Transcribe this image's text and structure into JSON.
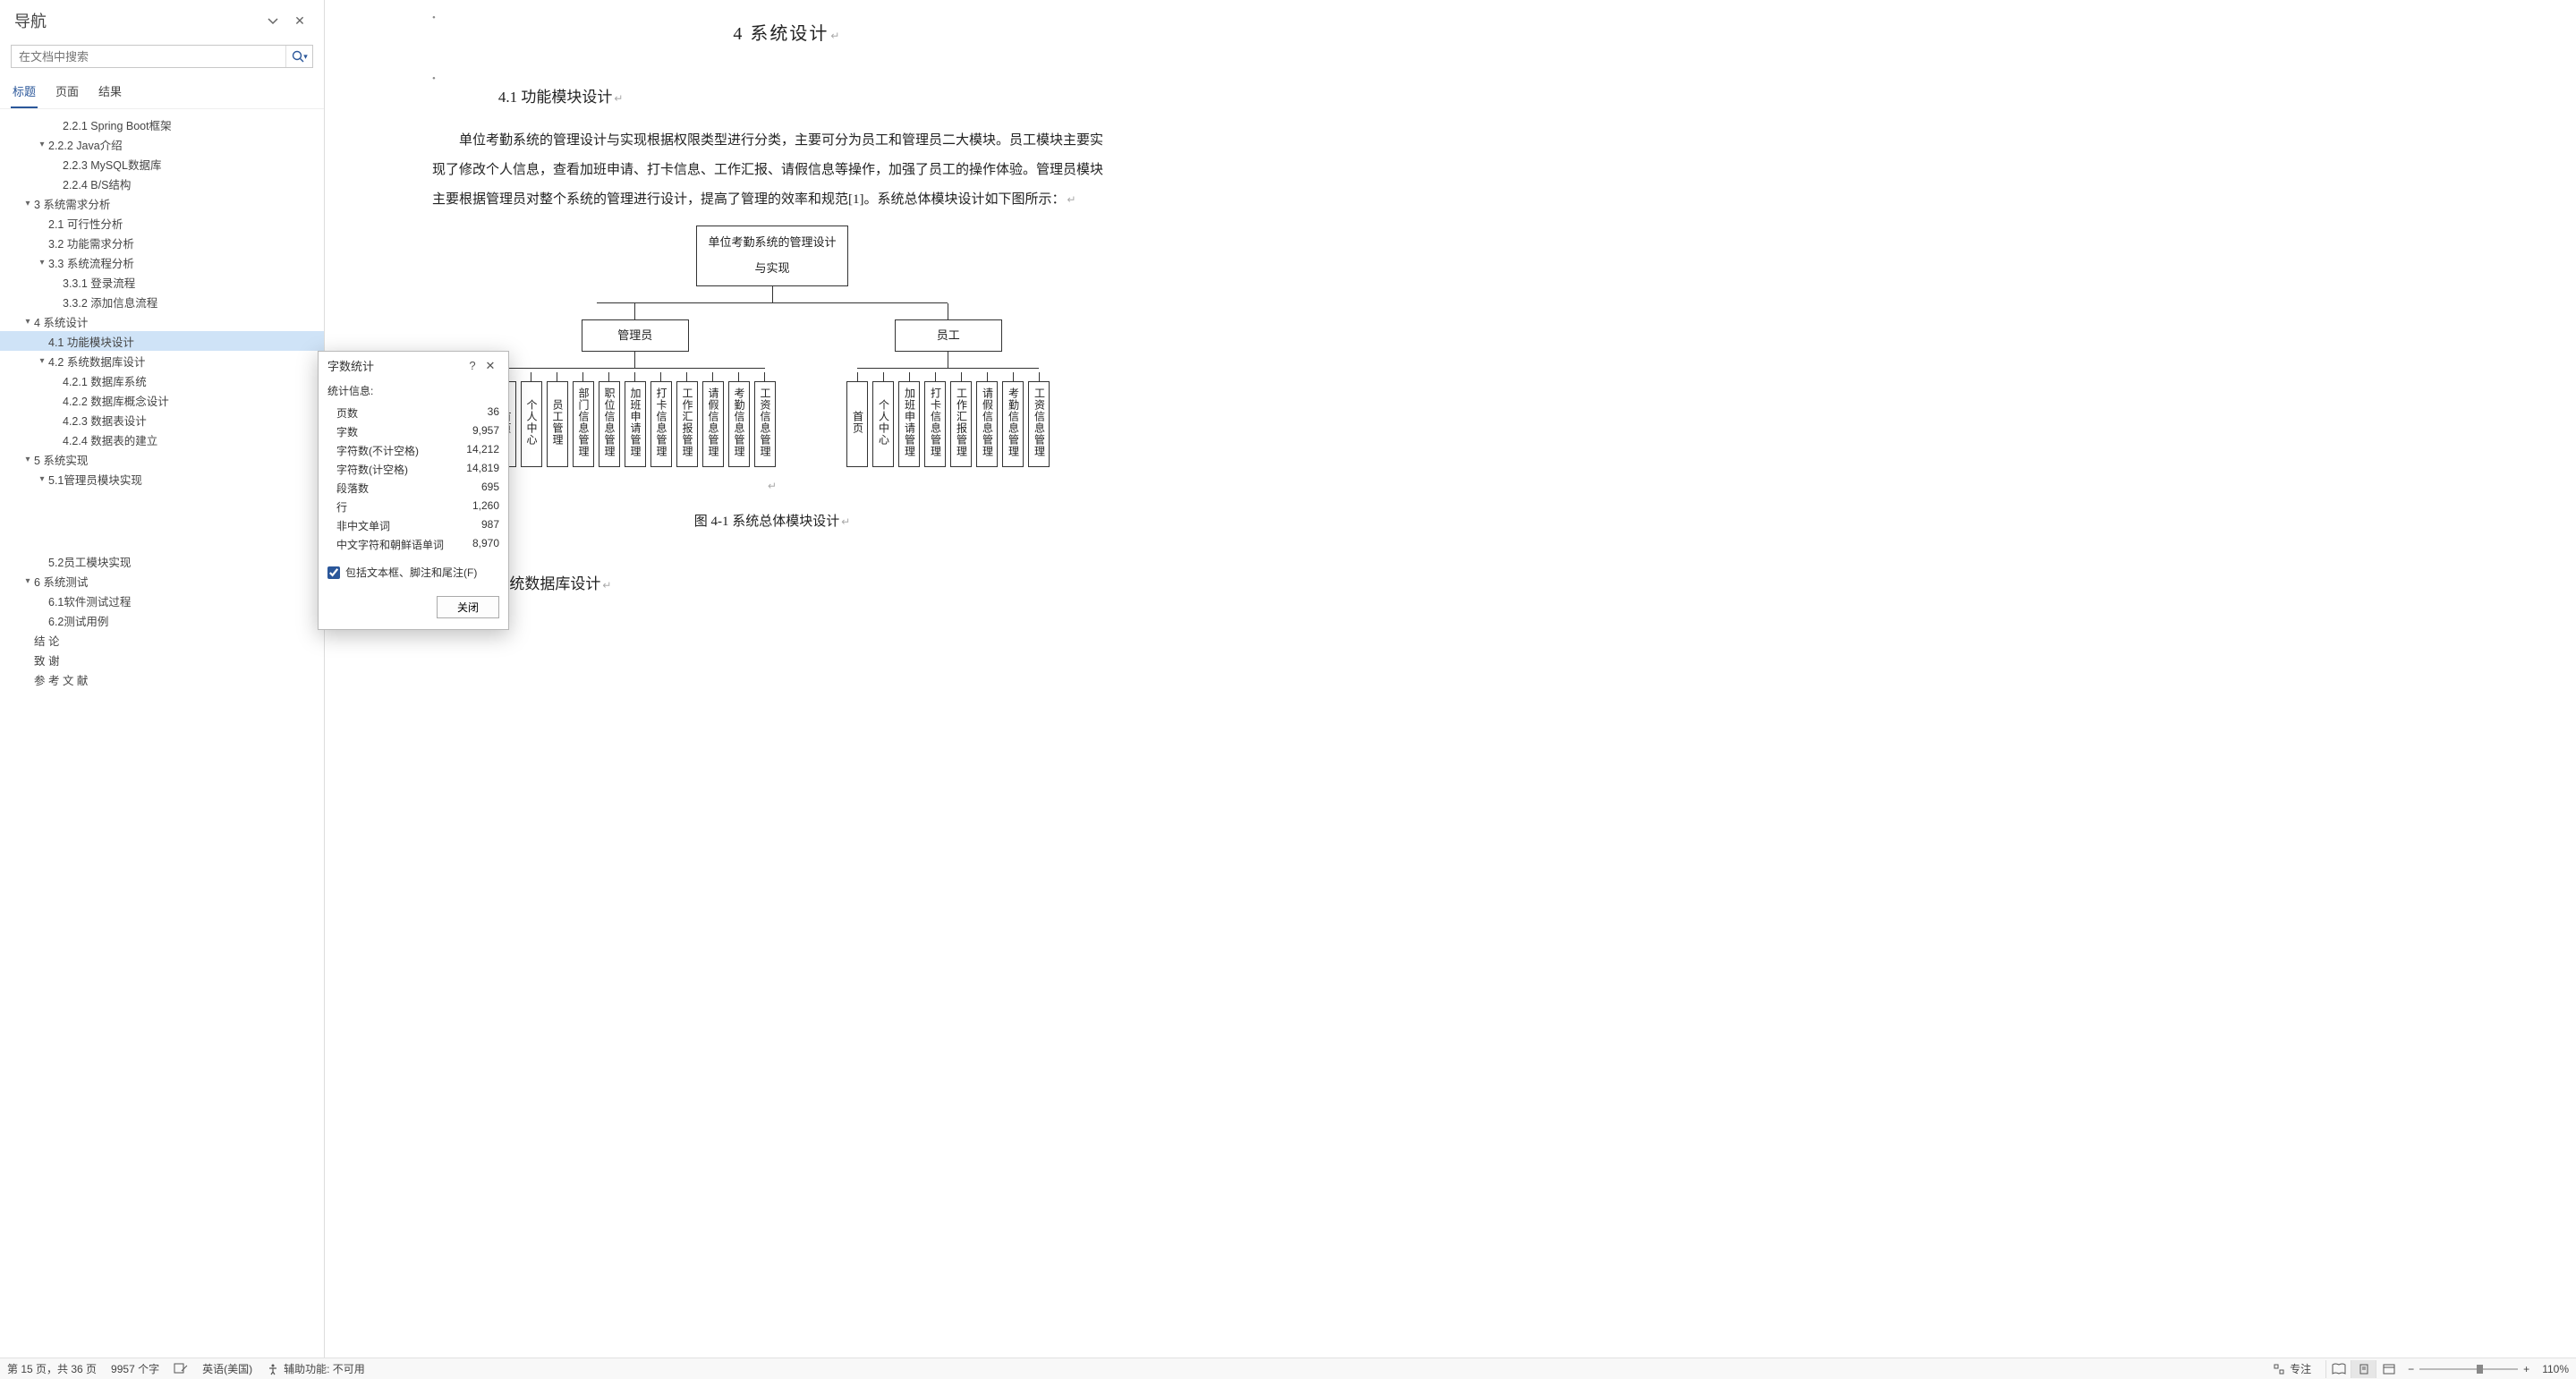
{
  "nav": {
    "title": "导航",
    "search_placeholder": "在文档中搜索",
    "tabs": {
      "headings": "标题",
      "pages": "页面",
      "results": "结果"
    },
    "tree": [
      {
        "level": 3,
        "caret": "",
        "label": "2.2.1 Spring Boot框架"
      },
      {
        "level": 2,
        "caret": "▾",
        "label": "2.2.2 Java介绍"
      },
      {
        "level": 3,
        "caret": "",
        "label": "2.2.3 MySQL数据库"
      },
      {
        "level": 3,
        "caret": "",
        "label": "2.2.4 B/S结构"
      },
      {
        "level": 1,
        "caret": "▾",
        "label": "3  系统需求分析"
      },
      {
        "level": 2,
        "caret": "",
        "label": "2.1 可行性分析"
      },
      {
        "level": 2,
        "caret": "",
        "label": "3.2 功能需求分析"
      },
      {
        "level": 2,
        "caret": "▾",
        "label": "3.3 系统流程分析"
      },
      {
        "level": 3,
        "caret": "",
        "label": "3.3.1 登录流程"
      },
      {
        "level": 3,
        "caret": "",
        "label": "3.3.2 添加信息流程"
      },
      {
        "level": 1,
        "caret": "▾",
        "label": "4  系统设计"
      },
      {
        "level": 2,
        "caret": "",
        "label": "4.1 功能模块设计",
        "selected": true
      },
      {
        "level": 2,
        "caret": "▾",
        "label": "4.2 系统数据库设计"
      },
      {
        "level": 3,
        "caret": "",
        "label": "4.2.1 数据库系统"
      },
      {
        "level": 3,
        "caret": "",
        "label": "4.2.2 数据库概念设计"
      },
      {
        "level": 3,
        "caret": "",
        "label": "4.2.3 数据表设计"
      },
      {
        "level": 3,
        "caret": "",
        "label": "4.2.4 数据表的建立"
      },
      {
        "level": 1,
        "caret": "▾",
        "label": "5  系统实现"
      },
      {
        "level": 2,
        "caret": "▾",
        "label": "5.1管理员模块实现"
      },
      {
        "level": 2,
        "caret": "",
        "label": "5.2员工模块实现",
        "gap_before": true
      },
      {
        "level": 1,
        "caret": "▾",
        "label": "6  系统测试"
      },
      {
        "level": 2,
        "caret": "",
        "label": "6.1软件测试过程"
      },
      {
        "level": 2,
        "caret": "",
        "label": "6.2测试用例"
      },
      {
        "level": 1,
        "caret": "",
        "label": "结  论"
      },
      {
        "level": 1,
        "caret": "",
        "label": "致  谢"
      },
      {
        "level": 1,
        "caret": "",
        "label": "参 考 文 献"
      }
    ]
  },
  "doc": {
    "h1": "4  系统设计",
    "h2a": "4.1 功能模块设计",
    "paragraph": "单位考勤系统的管理设计与实现根据权限类型进行分类，主要可分为员工和管理员二大模块。员工模块主要实现了修改个人信息，查看加班申请、打卡信息、工作汇报、请假信息等操作，加强了员工的操作体验。管理员模块主要根据管理员对整个系统的管理进行设计，提高了管理的效率和规范[1]。系统总体模块设计如下图所示：",
    "fig_caption": "图 4-1  系统总体模块设计",
    "h2b": "4.2 系统数据库设计",
    "chart": {
      "root": "单位考勤系统的管理设计与实现",
      "branches": [
        {
          "name": "管理员",
          "leaves": [
            "首页",
            "个人中心",
            "员工管理",
            "部门信息管理",
            "职位信息管理",
            "加班申请管理",
            "打卡信息管理",
            "工作汇报管理",
            "请假信息管理",
            "考勤信息管理",
            "工资信息管理"
          ]
        },
        {
          "name": "员工",
          "leaves": [
            "首页",
            "个人中心",
            "加班申请管理",
            "打卡信息管理",
            "工作汇报管理",
            "请假信息管理",
            "考勤信息管理",
            "工资信息管理"
          ]
        }
      ]
    }
  },
  "dialog": {
    "title": "字数统计",
    "subtitle": "统计信息:",
    "rows": [
      {
        "label": "页数",
        "value": "36"
      },
      {
        "label": "字数",
        "value": "9,957"
      },
      {
        "label": "字符数(不计空格)",
        "value": "14,212"
      },
      {
        "label": "字符数(计空格)",
        "value": "14,819"
      },
      {
        "label": "段落数",
        "value": "695"
      },
      {
        "label": "行",
        "value": "1,260"
      },
      {
        "label": "非中文单词",
        "value": "987"
      },
      {
        "label": "中文字符和朝鲜语单词",
        "value": "8,970"
      }
    ],
    "checkbox_label": "包括文本框、脚注和尾注(F)",
    "close_btn": "关闭"
  },
  "status": {
    "page": "第 15 页，共 36 页",
    "words": "9957 个字",
    "lang": "英语(美国)",
    "a11y": "辅助功能: 不可用",
    "focus": "专注",
    "zoom": "110%"
  }
}
